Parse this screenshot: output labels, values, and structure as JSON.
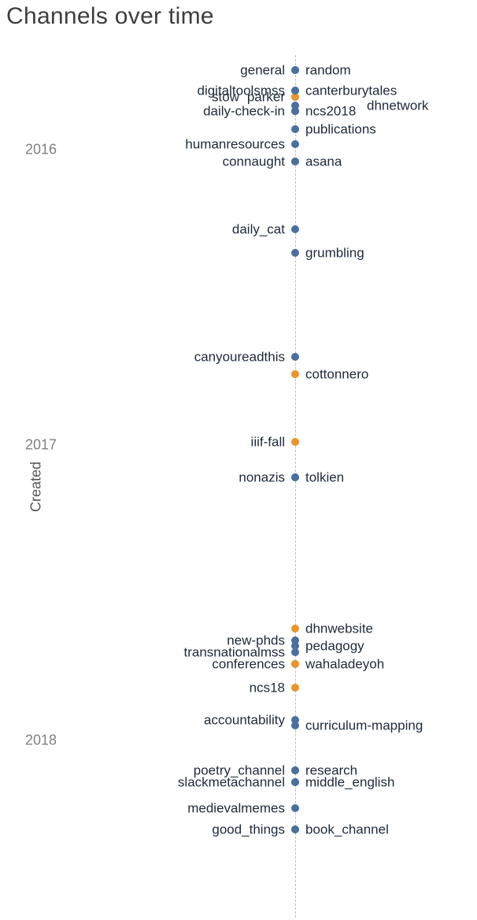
{
  "title": "Channels over time",
  "ylabel": "Created",
  "chart_data": {
    "type": "scatter",
    "xlabel": "",
    "ylabel": "Created",
    "title": "Channels over time",
    "y_ticks": [
      2016,
      2017,
      2018
    ],
    "y_range": [
      2015.68,
      2018.6
    ],
    "x_axis": "categorical-single-column",
    "series": [
      {
        "name": "blue",
        "color": "#4a6fa0"
      },
      {
        "name": "orange",
        "color": "#ec942a"
      }
    ],
    "points": [
      {
        "label": "general",
        "y": 2015.73,
        "series": "blue",
        "side": "left"
      },
      {
        "label": "random",
        "y": 2015.73,
        "series": "blue",
        "side": "right"
      },
      {
        "label": "digitaltoolsmss",
        "y": 2015.8,
        "series": "blue",
        "side": "left"
      },
      {
        "label": "stow",
        "y": 2015.82,
        "series": "blue",
        "side": "left",
        "lx_off": -58
      },
      {
        "label": "parker",
        "y": 2015.82,
        "series": "orange",
        "side": "left",
        "lx_off": 0
      },
      {
        "label": "canterburytales",
        "y": 2015.8,
        "series": "blue",
        "side": "right"
      },
      {
        "label": "daily-check-in",
        "y": 2015.87,
        "series": "blue",
        "side": "left"
      },
      {
        "label": "ncs2018",
        "y": 2015.87,
        "series": "blue",
        "side": "right",
        "lx_off": 0
      },
      {
        "label": "dhnetwork",
        "y": 2015.85,
        "series": "blue",
        "side": "right",
        "lx_off": 78
      },
      {
        "label": "publications",
        "y": 2015.93,
        "series": "blue",
        "side": "right"
      },
      {
        "label": "humanresources",
        "y": 2015.98,
        "series": "blue",
        "side": "left"
      },
      {
        "label": "connaught",
        "y": 2016.04,
        "series": "orange",
        "side": "left"
      },
      {
        "label": "asana",
        "y": 2016.04,
        "series": "blue",
        "side": "right"
      },
      {
        "label": "daily_cat",
        "y": 2016.27,
        "series": "blue",
        "side": "left"
      },
      {
        "label": "grumbling",
        "y": 2016.35,
        "series": "blue",
        "side": "right"
      },
      {
        "label": "canyoureadthis",
        "y": 2016.7,
        "series": "blue",
        "side": "left"
      },
      {
        "label": "cottonnero",
        "y": 2016.76,
        "series": "orange",
        "side": "right"
      },
      {
        "label": "iiif-fall",
        "y": 2016.99,
        "series": "orange",
        "side": "left"
      },
      {
        "label": "nonazis",
        "y": 2017.11,
        "series": "blue",
        "side": "left"
      },
      {
        "label": "tolkien",
        "y": 2017.11,
        "series": "blue",
        "side": "right"
      },
      {
        "label": "dhnwebsite",
        "y": 2017.62,
        "series": "orange",
        "side": "right"
      },
      {
        "label": "new-phds",
        "y": 2017.66,
        "series": "blue",
        "side": "left"
      },
      {
        "label": "transnationalmss",
        "y": 2017.7,
        "series": "blue",
        "side": "left"
      },
      {
        "label": "pedagogy",
        "y": 2017.68,
        "series": "blue",
        "side": "right"
      },
      {
        "label": "conferences",
        "y": 2017.74,
        "series": "blue",
        "side": "left"
      },
      {
        "label": "wahaladeyoh",
        "y": 2017.74,
        "series": "orange",
        "side": "right"
      },
      {
        "label": "ncs18",
        "y": 2017.82,
        "series": "orange",
        "side": "left"
      },
      {
        "label": "accountability",
        "y": 2017.93,
        "series": "blue",
        "side": "left"
      },
      {
        "label": "curriculum-mapping",
        "y": 2017.95,
        "series": "blue",
        "side": "right"
      },
      {
        "label": "poetry_channel",
        "y": 2018.1,
        "series": "blue",
        "side": "left"
      },
      {
        "label": "research",
        "y": 2018.1,
        "series": "blue",
        "side": "right"
      },
      {
        "label": "slackmetachannel",
        "y": 2018.14,
        "series": "blue",
        "side": "left"
      },
      {
        "label": "middle_english",
        "y": 2018.14,
        "series": "blue",
        "side": "right"
      },
      {
        "label": "medievalmemes",
        "y": 2018.23,
        "series": "blue",
        "side": "left"
      },
      {
        "label": "good_things",
        "y": 2018.3,
        "series": "blue",
        "side": "left"
      },
      {
        "label": "book_channel",
        "y": 2018.3,
        "series": "blue",
        "side": "right"
      }
    ]
  }
}
